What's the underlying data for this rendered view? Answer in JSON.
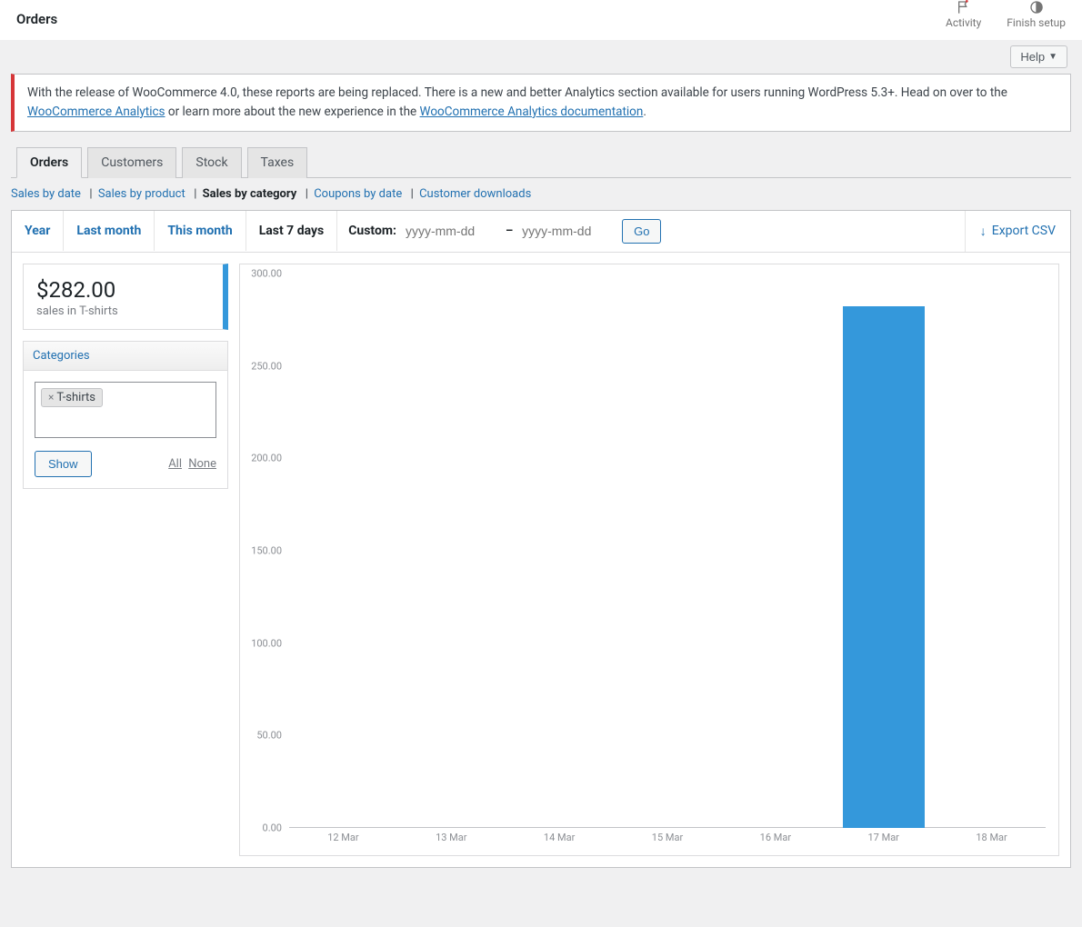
{
  "header": {
    "title": "Orders",
    "activity": "Activity",
    "finish_setup": "Finish setup",
    "help": "Help"
  },
  "notice": {
    "text_pre": "With the release of WooCommerce 4.0, these reports are being replaced. There is a new and better Analytics section available for users running WordPress 5.3+. Head on over to the ",
    "link1": "WooCommerce Analytics",
    "text_mid": " or learn more about the new experience in the ",
    "link2": "WooCommerce Analytics documentation",
    "text_post": "."
  },
  "tabs": {
    "orders": "Orders",
    "customers": "Customers",
    "stock": "Stock",
    "taxes": "Taxes"
  },
  "subtabs": {
    "sales_by_date": "Sales by date",
    "sales_by_product": "Sales by product",
    "sales_by_category": "Sales by category",
    "coupons_by_date": "Coupons by date",
    "customer_downloads": "Customer downloads"
  },
  "range": {
    "year": "Year",
    "last_month": "Last month",
    "this_month": "This month",
    "last_7_days": "Last 7 days",
    "custom_label": "Custom:",
    "date_placeholder": "yyyy-mm-dd",
    "go": "Go",
    "export_csv": "Export CSV"
  },
  "stat": {
    "value": "$282.00",
    "label": "sales in T-shirts"
  },
  "categories": {
    "header": "Categories",
    "tag": "T-shirts",
    "show": "Show",
    "all": "All",
    "none": "None"
  },
  "chart_data": {
    "type": "bar",
    "categories": [
      "12 Mar",
      "13 Mar",
      "14 Mar",
      "15 Mar",
      "16 Mar",
      "17 Mar",
      "18 Mar"
    ],
    "values": [
      0,
      0,
      0,
      0,
      0,
      282,
      0
    ],
    "ylim": [
      0,
      300
    ],
    "y_ticks": [
      "0.00",
      "50.00",
      "100.00",
      "150.00",
      "200.00",
      "250.00",
      "300.00"
    ]
  }
}
